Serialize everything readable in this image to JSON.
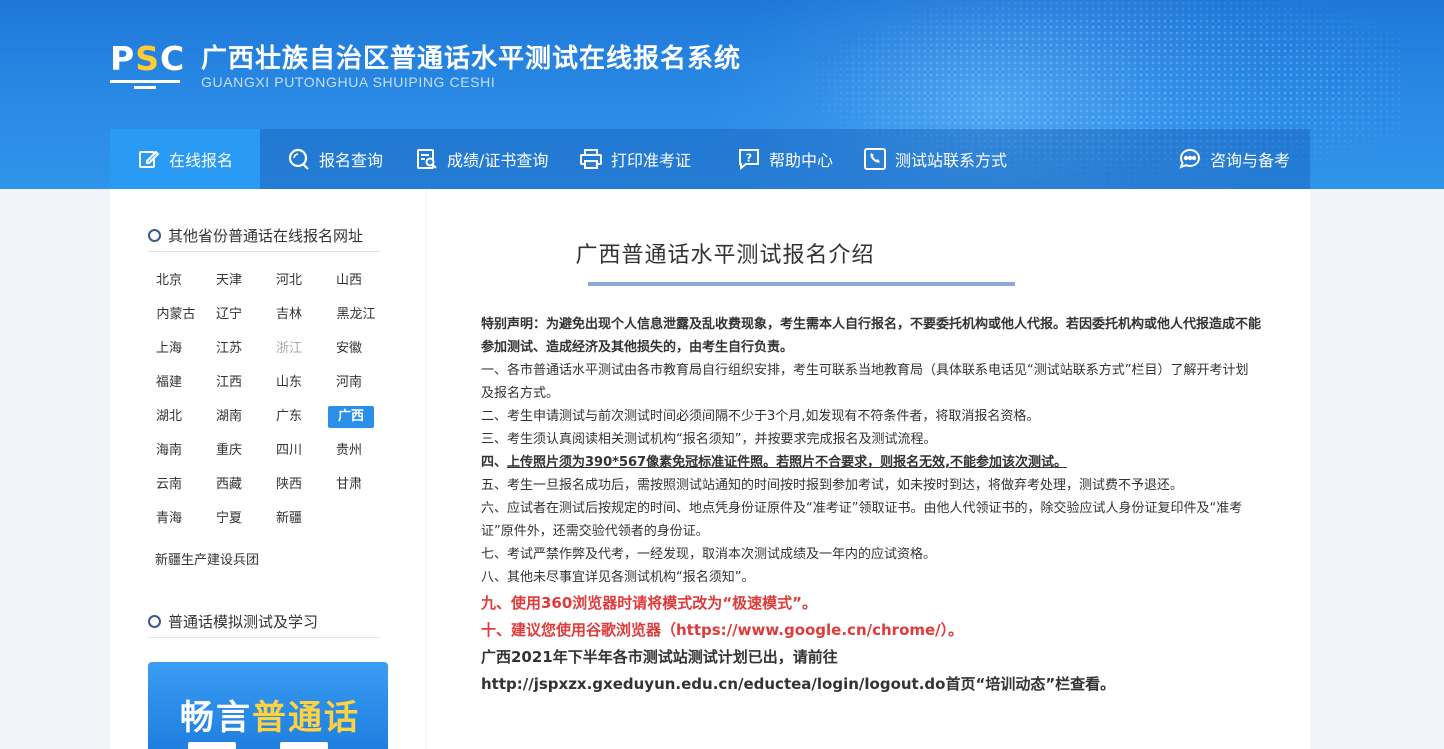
{
  "header": {
    "logo": {
      "p": "P",
      "s": "S",
      "c": "C"
    },
    "title": "广西壮族自治区普通话水平测试在线报名系统",
    "subtitle": "GUANGXI PUTONGHUA SHUIPING CESHI"
  },
  "nav": {
    "items": [
      {
        "label": "在线报名",
        "icon": "edit-icon"
      },
      {
        "label": "报名查询",
        "icon": "search-icon"
      },
      {
        "label": "成绩/证书查询",
        "icon": "certificate-search-icon"
      },
      {
        "label": "打印准考证",
        "icon": "printer-icon"
      },
      {
        "label": "帮助中心",
        "icon": "help-icon"
      },
      {
        "label": "测试站联系方式",
        "icon": "phone-icon"
      },
      {
        "label": "咨询与备考",
        "icon": "chat-icon"
      }
    ],
    "active_color": "#2a9bf5"
  },
  "sidebar": {
    "provinces_title": "其他省份普通话在线报名网址",
    "provinces": [
      [
        "北京",
        "天津",
        "河北",
        "山西"
      ],
      [
        "内蒙古",
        "辽宁",
        "吉林",
        "黑龙江"
      ],
      [
        "上海",
        "江苏",
        "浙江",
        "安徽"
      ],
      [
        "福建",
        "江西",
        "山东",
        "河南"
      ],
      [
        "湖北",
        "湖南",
        "广东",
        "广西"
      ],
      [
        "海南",
        "重庆",
        "四川",
        "贵州"
      ],
      [
        "云南",
        "西藏",
        "陕西",
        "甘肃"
      ],
      [
        "青海",
        "宁夏",
        "新疆"
      ]
    ],
    "current_province": "广西",
    "disabled_province": "浙江",
    "corps": "新疆生产建设兵团",
    "study_title": "普通话模拟测试及学习",
    "banner": {
      "part1": "畅言",
      "part2": "普通话"
    }
  },
  "content": {
    "title": "广西普通话水平测试报名介绍",
    "statement": "特别声明：为避免出现个人信息泄露及乱收费现象，考生需本人自行报名，不要委托机构或他人代报。若因委托机构或他人代报造成不能参加测试、造成经济及其他损失的，由考生自行负责。",
    "item1": "一、各市普通话水平测试由各市教育局自行组织安排，考生可联系当地教育局（具体联系电话见“测试站联系方式”栏目）了解开考计划及报名方式。",
    "item2": "二、考生申请测试与前次测试时间必须间隔不少于3个月,如发现有不符条件者，将取消报名资格。",
    "item3": "三、考生须认真阅读相关测试机构“报名须知”，并按要求完成报名及测试流程。",
    "item4_prefix": "四、",
    "item4": "上传照片须为390*567像素免冠标准证件照。若照片不合要求，则报名无效,不能参加该次测试。",
    "item5": "五、考生一旦报名成功后，需按照测试站通知的时间按时报到参加考试，如未按时到达，将做弃考处理，测试费不予退还。",
    "item6": "六、应试者在测试后按规定的时间、地点凭身份证原件及“准考证”领取证书。由他人代领证书的，除交验应试人身份证复印件及“准考证”原件外，还需交验代领者的身份证。",
    "item7": "七、考试严禁作弊及代考，一经发现，取消本次测试成绩及一年内的应试资格。",
    "item8": "八、其他未尽事宜详见各测试机构“报名须知”。",
    "item9": "九、使用360浏览器时请将模式改为“极速模式”。",
    "item10": "十、建议您使用谷歌浏览器（https://www.google.cn/chrome/）。",
    "notice": "广西2021年下半年各市测试站测试计划已出，请前往http://jspxzx.gxeduyun.edu.cn/eductea/login/logout.do首页“培训动态”栏查看。",
    "red_color": "#e03a3a"
  }
}
